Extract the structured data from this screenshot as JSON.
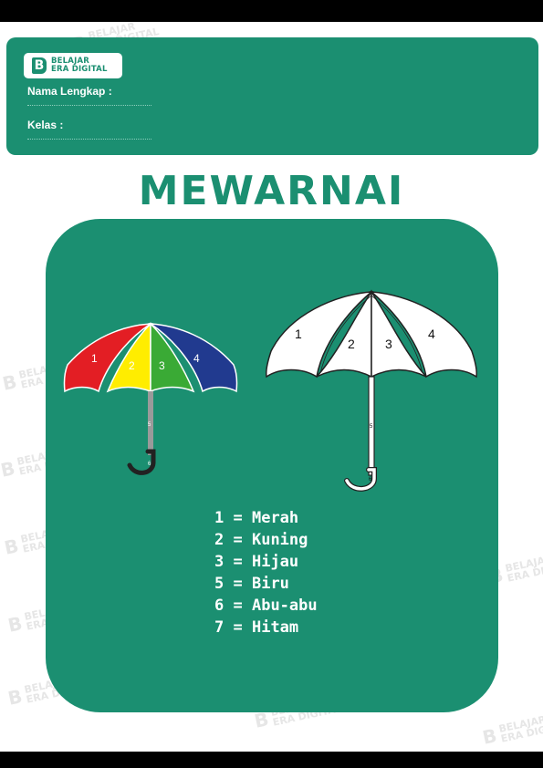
{
  "brand": {
    "line1": "BELAJAR",
    "line2": "ERA DIGITAL",
    "mark": "B"
  },
  "form": {
    "name_label": "Nama Lengkap :",
    "class_label": "Kelas :"
  },
  "title": "MEWARNAI",
  "umbrella_colored": {
    "labels": [
      "1",
      "2",
      "3",
      "4",
      "5",
      "6"
    ],
    "panel_colors": [
      "#e31e24",
      "#ffed00",
      "#3aaa35",
      "#213a8f"
    ],
    "shaft_color": "#9a9a9a",
    "handle_color": "#222222"
  },
  "umbrella_outline": {
    "labels": [
      "1",
      "2",
      "3",
      "4",
      "5",
      "6"
    ]
  },
  "legend": [
    {
      "number": "1",
      "color": "Merah"
    },
    {
      "number": "2",
      "color": "Kuning"
    },
    {
      "number": "3",
      "color": "Hijau"
    },
    {
      "number": "5",
      "color": "Biru"
    },
    {
      "number": "6",
      "color": "Abu-abu"
    },
    {
      "number": "7",
      "color": "Hitam"
    }
  ],
  "colors": {
    "accent": "#1b8f71",
    "background": "#ffffff"
  }
}
